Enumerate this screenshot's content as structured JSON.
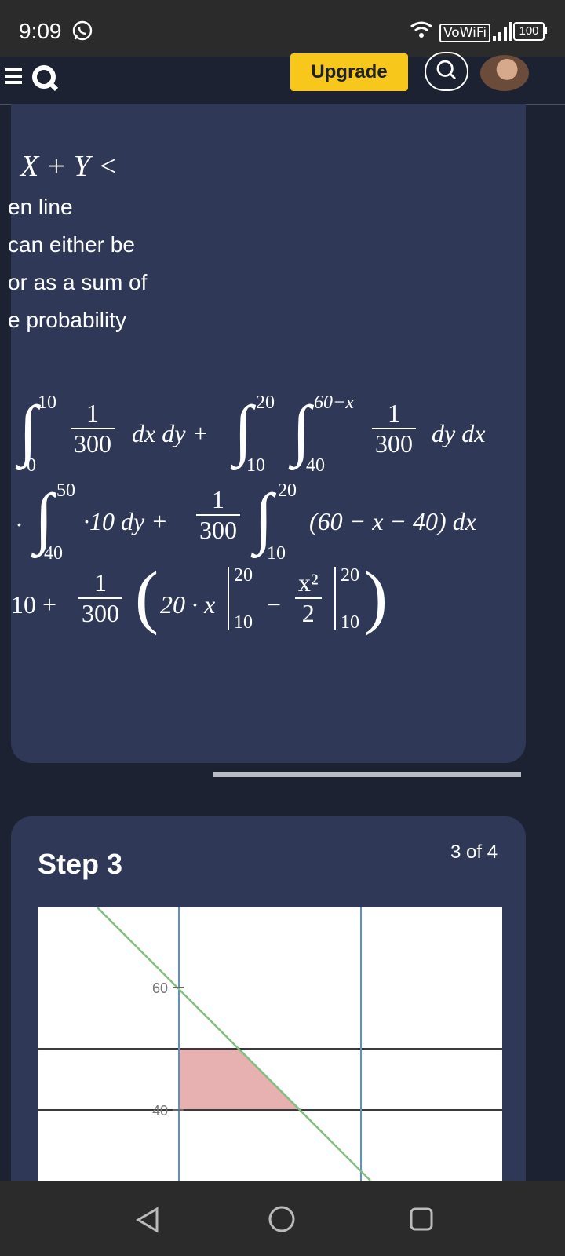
{
  "status_bar": {
    "time": "9:09",
    "vowifi": "VoWiFi",
    "battery": "100"
  },
  "header": {
    "upgrade_label": "Upgrade"
  },
  "solution": {
    "expr_fragment": "X + Y <",
    "text_lines": [
      "en line",
      "can either be",
      "or as a sum of",
      "e probability"
    ],
    "eq1": {
      "int1_upper": "10",
      "int1_lower": "0",
      "frac_num": "1",
      "frac_den": "300",
      "diff1": "dx dy +",
      "int2_upper": "20",
      "int2_lower": "10",
      "int3_upper": "60−x",
      "int3_lower": "40",
      "frac2_num": "1",
      "frac2_den": "300",
      "diff2": "dy dx"
    },
    "eq2": {
      "int_upper": "50",
      "int_lower": "40",
      "term": "·10 dy +",
      "frac_num": "1",
      "frac_den": "300",
      "int2_upper": "20",
      "int2_lower": "10",
      "integrand": "(60 − x − 40) dx"
    },
    "eq3": {
      "lead": "10 +",
      "frac_num": "1",
      "frac_den": "300",
      "inner": "20 · x",
      "eval_upper": "20",
      "eval_lower": "10",
      "minus": "−",
      "frac2_num": "x²",
      "frac2_den": "2",
      "eval2_upper": "20",
      "eval2_lower": "10"
    }
  },
  "step": {
    "title": "Step 3",
    "count": "3 of 4",
    "graph": {
      "tick_60": "60",
      "tick_40": "40"
    }
  },
  "colors": {
    "accent": "#f7c81b",
    "card": "#2f3957",
    "shade": "#e8b1b1",
    "diag_line": "#7fbf7f",
    "axis_blue": "#5b8fd6"
  }
}
